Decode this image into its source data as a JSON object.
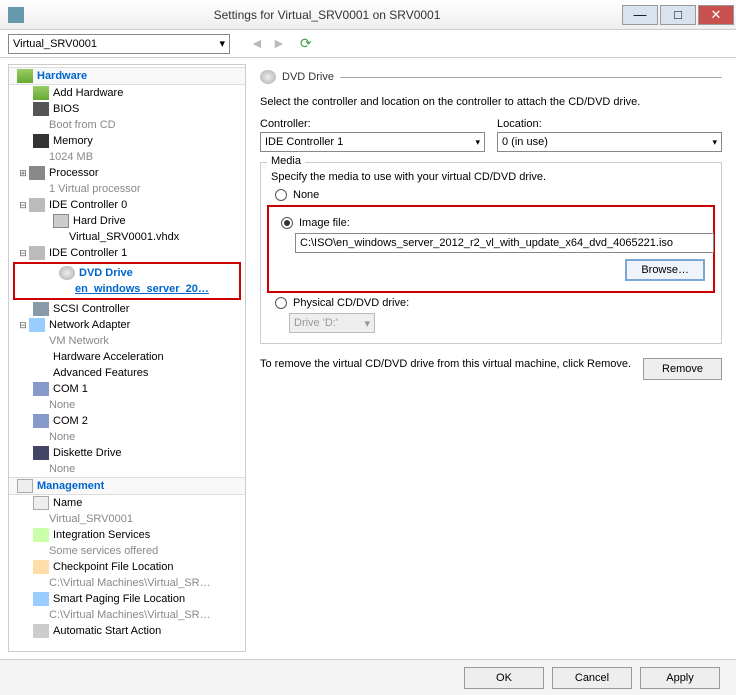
{
  "title": "Settings for Virtual_SRV0001 on SRV0001",
  "vmSelectValue": "Virtual_SRV0001",
  "sections": {
    "hardware": "Hardware",
    "management": "Management"
  },
  "tree": {
    "addHardware": "Add Hardware",
    "bios": "BIOS",
    "biosSub": "Boot from CD",
    "memory": "Memory",
    "memorySub": "1024 MB",
    "processor": "Processor",
    "processorSub": "1 Virtual processor",
    "ide0": "IDE Controller 0",
    "hardDrive": "Hard Drive",
    "hardDriveSub": "Virtual_SRV0001.vhdx",
    "ide1": "IDE Controller 1",
    "dvd": "DVD Drive",
    "dvdSub": "en_windows_server_20…",
    "scsi": "SCSI Controller",
    "net": "Network Adapter",
    "netSub": "VM Network",
    "hwAccel": "Hardware Acceleration",
    "advFeat": "Advanced Features",
    "com1": "COM 1",
    "com1Sub": "None",
    "com2": "COM 2",
    "com2Sub": "None",
    "diskette": "Diskette Drive",
    "disketteSub": "None",
    "name": "Name",
    "nameSub": "Virtual_SRV0001",
    "integ": "Integration Services",
    "integSub": "Some services offered",
    "checkpoint": "Checkpoint File Location",
    "checkpointSub": "C:\\Virtual Machines\\Virtual_SR…",
    "paging": "Smart Paging File Location",
    "pagingSub": "C:\\Virtual Machines\\Virtual_SR…",
    "autoStart": "Automatic Start Action"
  },
  "detail": {
    "heading": "DVD Drive",
    "instruction": "Select the controller and location on the controller to attach the CD/DVD drive.",
    "controllerLabel": "Controller:",
    "controllerValue": "IDE Controller 1",
    "locationLabel": "Location:",
    "locationValue": "0 (in use)",
    "mediaLegend": "Media",
    "mediaDesc": "Specify the media to use with your virtual CD/DVD drive.",
    "optNone": "None",
    "optImage": "Image file:",
    "imagePath": "C:\\ISO\\en_windows_server_2012_r2_vl_with_update_x64_dvd_4065221.iso",
    "browse": "Browse…",
    "optPhysical": "Physical CD/DVD drive:",
    "physicalValue": "Drive 'D:'",
    "removeInstr": "To remove the virtual CD/DVD drive from this virtual machine, click Remove.",
    "remove": "Remove"
  },
  "footer": {
    "ok": "OK",
    "cancel": "Cancel",
    "apply": "Apply"
  }
}
